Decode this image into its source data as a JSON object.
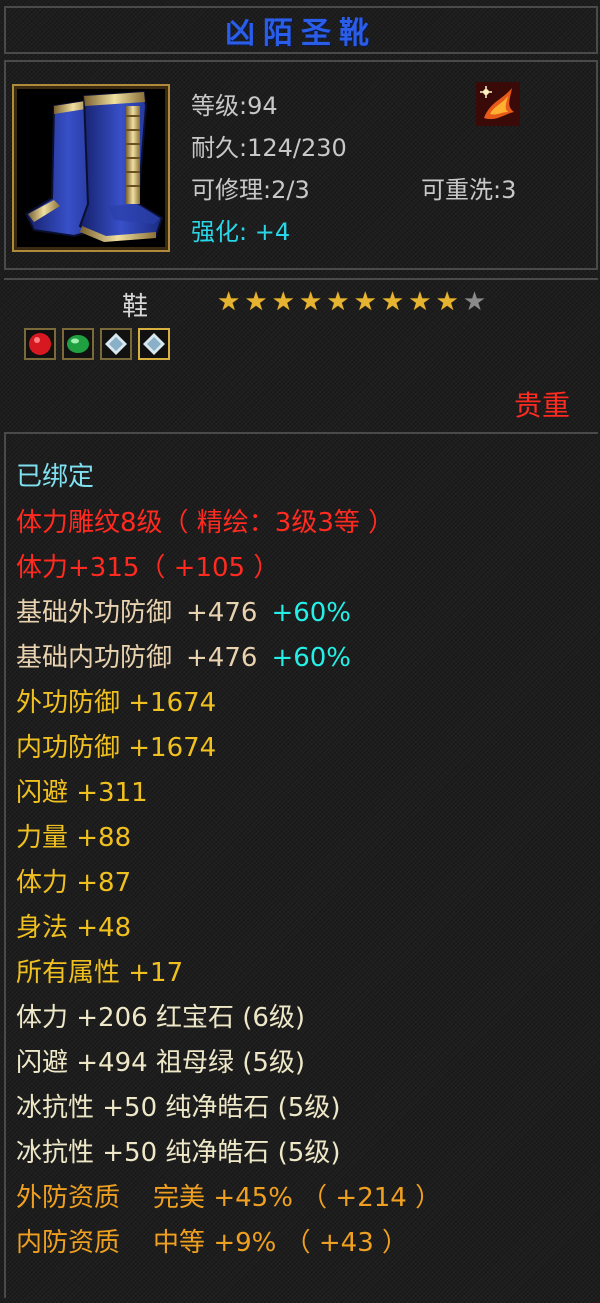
{
  "title": "凶陌圣靴",
  "header": {
    "level": "等级:94",
    "durability": "耐久:124/230",
    "repairable": "可修理:2/3",
    "rewashable": "可重洗:3",
    "enhance_label": "强化:",
    "enhance_value": "+4"
  },
  "item": {
    "type": "鞋",
    "stars_filled": 9,
    "stars_total": 10,
    "rarity": "贵重"
  },
  "gems": [
    "ruby-gem-icon",
    "emerald-gem-icon",
    "diamond-gem-icon",
    "diamond-gem-icon"
  ],
  "attributes": {
    "bound": "已绑定",
    "engrave": "体力雕纹8级（ 精绘：3级3等 ）",
    "stamina_engrave": "体力+315（ +105 ）",
    "base_outer_def_label": "基础外功防御",
    "base_outer_def_value": "+476",
    "base_outer_def_pct": "+60%",
    "base_inner_def_label": "基础内功防御",
    "base_inner_def_value": "+476",
    "base_inner_def_pct": "+60%",
    "outer_def": "外功防御 +1674",
    "inner_def": "内功防御 +1674",
    "dodge": "闪避 +311",
    "strength": "力量 +88",
    "stamina": "体力 +87",
    "agility": "身法 +48",
    "all_attr": "所有属性 +17",
    "gem1": "体力 +206 红宝石 (6级)",
    "gem2": "闪避 +494 祖母绿 (5级)",
    "gem3": "冰抗性 +50 纯净皓石 (5级)",
    "gem4": "冰抗性 +50 纯净皓石 (5级)",
    "quality_outer": "外防资质    完美 +45% （ +214 ）",
    "quality_inner": "内防资质    中等 +9% （ +43 ）"
  }
}
